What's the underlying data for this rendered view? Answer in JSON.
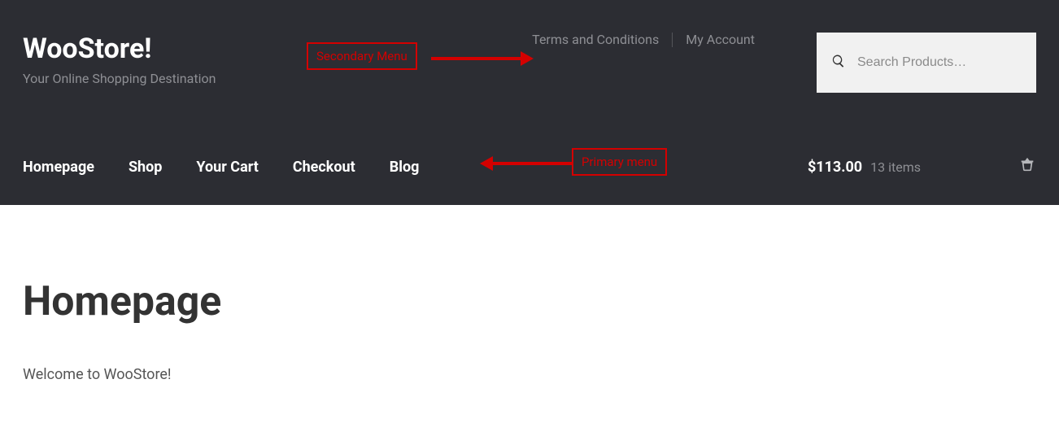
{
  "brand": {
    "title": "WooStore!",
    "tagline": "Your Online Shopping Destination"
  },
  "secondary_menu": {
    "items": [
      {
        "label": "Terms and Conditions"
      },
      {
        "label": "My Account"
      }
    ]
  },
  "search": {
    "placeholder": "Search Products…"
  },
  "primary_menu": {
    "items": [
      {
        "label": "Homepage"
      },
      {
        "label": "Shop"
      },
      {
        "label": "Your Cart"
      },
      {
        "label": "Checkout"
      },
      {
        "label": "Blog"
      }
    ]
  },
  "cart": {
    "total": "$113.00",
    "count_label": "13 items"
  },
  "annotations": {
    "secondary_label": "Secondary Menu",
    "primary_label": "Primary menu"
  },
  "page": {
    "title": "Homepage",
    "welcome": "Welcome to WooStore!"
  }
}
